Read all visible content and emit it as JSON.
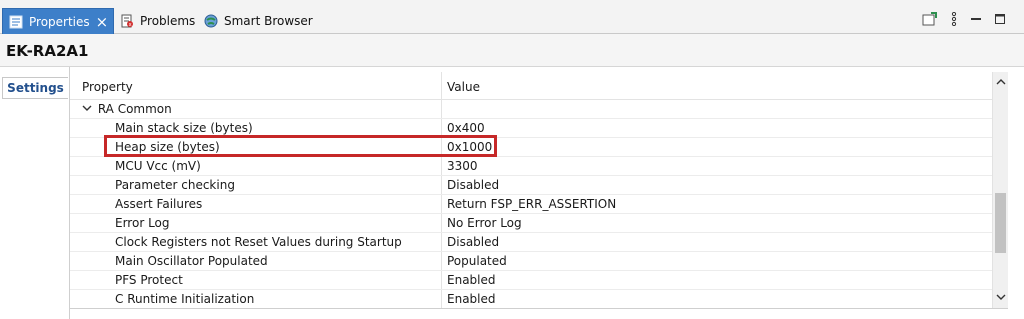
{
  "tabs": {
    "properties_label": "Properties",
    "problems_label": "Problems",
    "smart_browser_label": "Smart Browser"
  },
  "title": "EK-RA2A1",
  "side_tabs": {
    "settings_label": "Settings"
  },
  "table": {
    "col_property": "Property",
    "col_value": "Value",
    "group": "RA Common",
    "rows": [
      {
        "property": "Main stack size (bytes)",
        "value": "0x400"
      },
      {
        "property": "Heap size (bytes)",
        "value": "0x1000"
      },
      {
        "property": "MCU Vcc (mV)",
        "value": "3300"
      },
      {
        "property": "Parameter checking",
        "value": "Disabled"
      },
      {
        "property": "Assert Failures",
        "value": "Return FSP_ERR_ASSERTION"
      },
      {
        "property": "Error Log",
        "value": "No Error Log"
      },
      {
        "property": "Clock Registers not Reset Values during Startup",
        "value": "Disabled"
      },
      {
        "property": "Main Oscillator Populated",
        "value": "Populated"
      },
      {
        "property": "PFS Protect",
        "value": "Enabled"
      },
      {
        "property": "C Runtime Initialization",
        "value": "Enabled"
      }
    ]
  },
  "colors": {
    "active_tab": "#3d7fc9",
    "highlight": "#c62828",
    "settings_text": "#23508d"
  },
  "icons": [
    "properties-icon",
    "close-icon",
    "problems-icon",
    "smart-browser-icon",
    "pin-icon",
    "view-menu-icon",
    "minimize-icon",
    "maximize-icon",
    "chevron-down-icon",
    "scroll-up-icon",
    "scroll-down-icon"
  ]
}
